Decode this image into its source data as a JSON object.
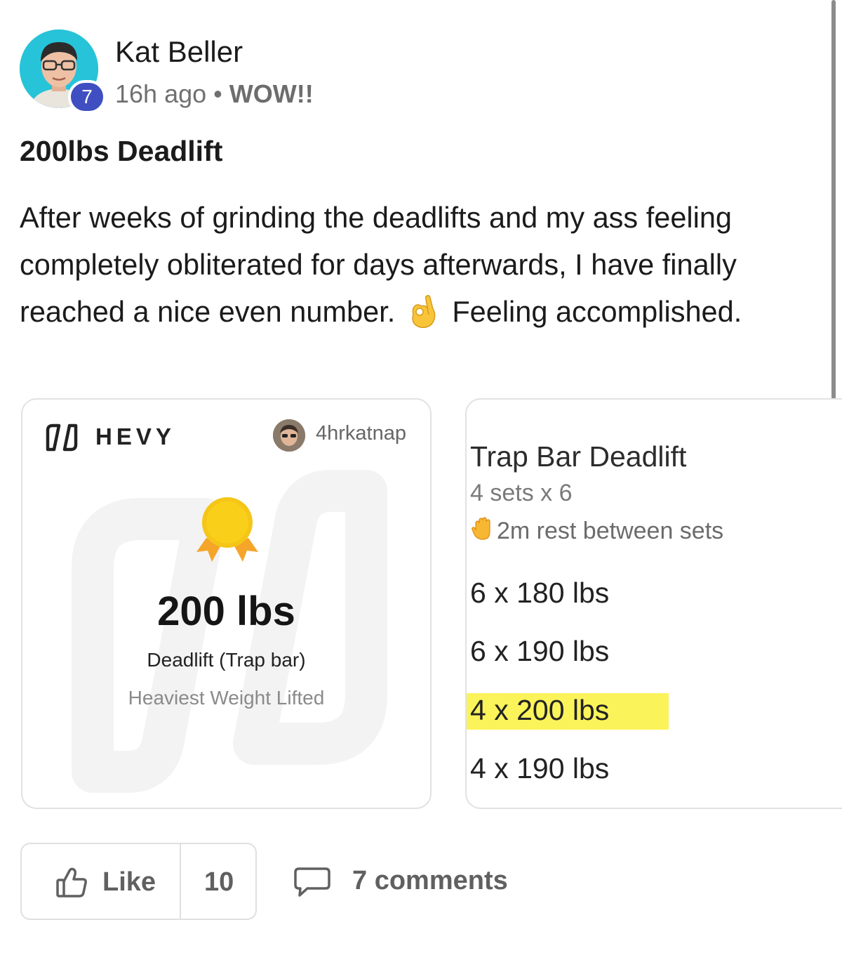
{
  "post": {
    "author": "Kat Beller",
    "badge": "7",
    "time": "16h ago",
    "separator": "•",
    "flair": "WOW!!",
    "title": "200lbs Deadlift",
    "body_before_emoji": "After weeks of grinding the deadlifts and my ass feeling completely obliterated for days afterwards, I have finally reached a nice even number.",
    "body_after_emoji": "Feeling accomplished.",
    "emoji": "ok-hand-icon"
  },
  "hevy_card": {
    "brand": "HEVY",
    "username": "4hrkatnap",
    "pr_value": "200 lbs",
    "exercise": "Deadlift (Trap bar)",
    "pr_type": "Heaviest Weight Lifted",
    "accent_color": "#f5c518"
  },
  "workout_card": {
    "exercise": "Trap Bar Deadlift",
    "sets_summary": "4 sets x 6",
    "rest": "2m rest between sets",
    "sets": [
      "6 x 180 lbs",
      "6 x 190 lbs",
      "4 x 200 lbs",
      "4 x 190 lbs"
    ],
    "highlighted_set": "4 x 200 lbs",
    "highlight_color": "#fbf35a"
  },
  "actions": {
    "like_label": "Like",
    "like_count": "10",
    "comments": "7 comments"
  },
  "colors": {
    "avatar_bg": "#27c3d8",
    "badge_bg": "#3f4fc1"
  }
}
